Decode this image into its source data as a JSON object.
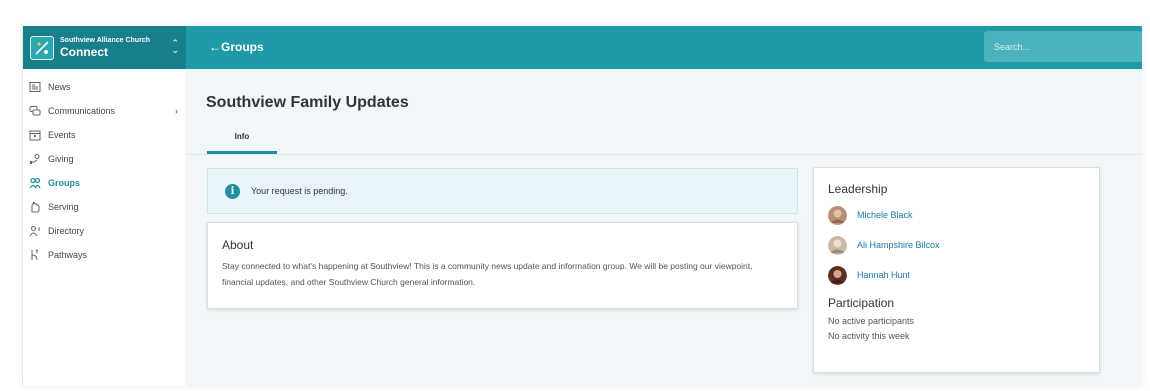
{
  "app": {
    "org_name": "Southview Alliance Church",
    "app_name": "Connect"
  },
  "header": {
    "back_label": "←Groups",
    "search_placeholder": "Search..."
  },
  "sidebar": {
    "items": [
      {
        "label": "News",
        "icon": "newspaper-icon"
      },
      {
        "label": "Communications",
        "icon": "chat-icon"
      },
      {
        "label": "Events",
        "icon": "calendar-icon"
      },
      {
        "label": "Giving",
        "icon": "hand-heart-icon"
      },
      {
        "label": "Groups",
        "icon": "people-icon"
      },
      {
        "label": "Serving",
        "icon": "hand-icon"
      },
      {
        "label": "Directory",
        "icon": "person-list-icon"
      },
      {
        "label": "Pathways",
        "icon": "pathway-icon"
      }
    ],
    "active_item": "Groups"
  },
  "main": {
    "title": "Southview Family Updates",
    "tabs": [
      {
        "label": "Info"
      }
    ],
    "alert_text": "Your request is pending.",
    "about": {
      "heading": "About",
      "description": "Stay connected to what's happening at Southview! This is a community news update and information group. We will be posting our viewpoint, financial updates, and other Southview Church general information."
    }
  },
  "side": {
    "leadership_heading": "Leadership",
    "leaders": [
      {
        "name": "Michele Black"
      },
      {
        "name": "Ali Hampshire Bilcox"
      },
      {
        "name": "Hannah Hunt"
      }
    ],
    "participation_heading": "Participation",
    "participation_lines": [
      "No active participants",
      "No activity this week"
    ]
  },
  "colors": {
    "header_teal": "#1f9aa6",
    "org_switch_teal": "#17808c",
    "accent": "#1f8fa0",
    "link": "#1f78a8",
    "main_bg": "#f1f7f9"
  }
}
